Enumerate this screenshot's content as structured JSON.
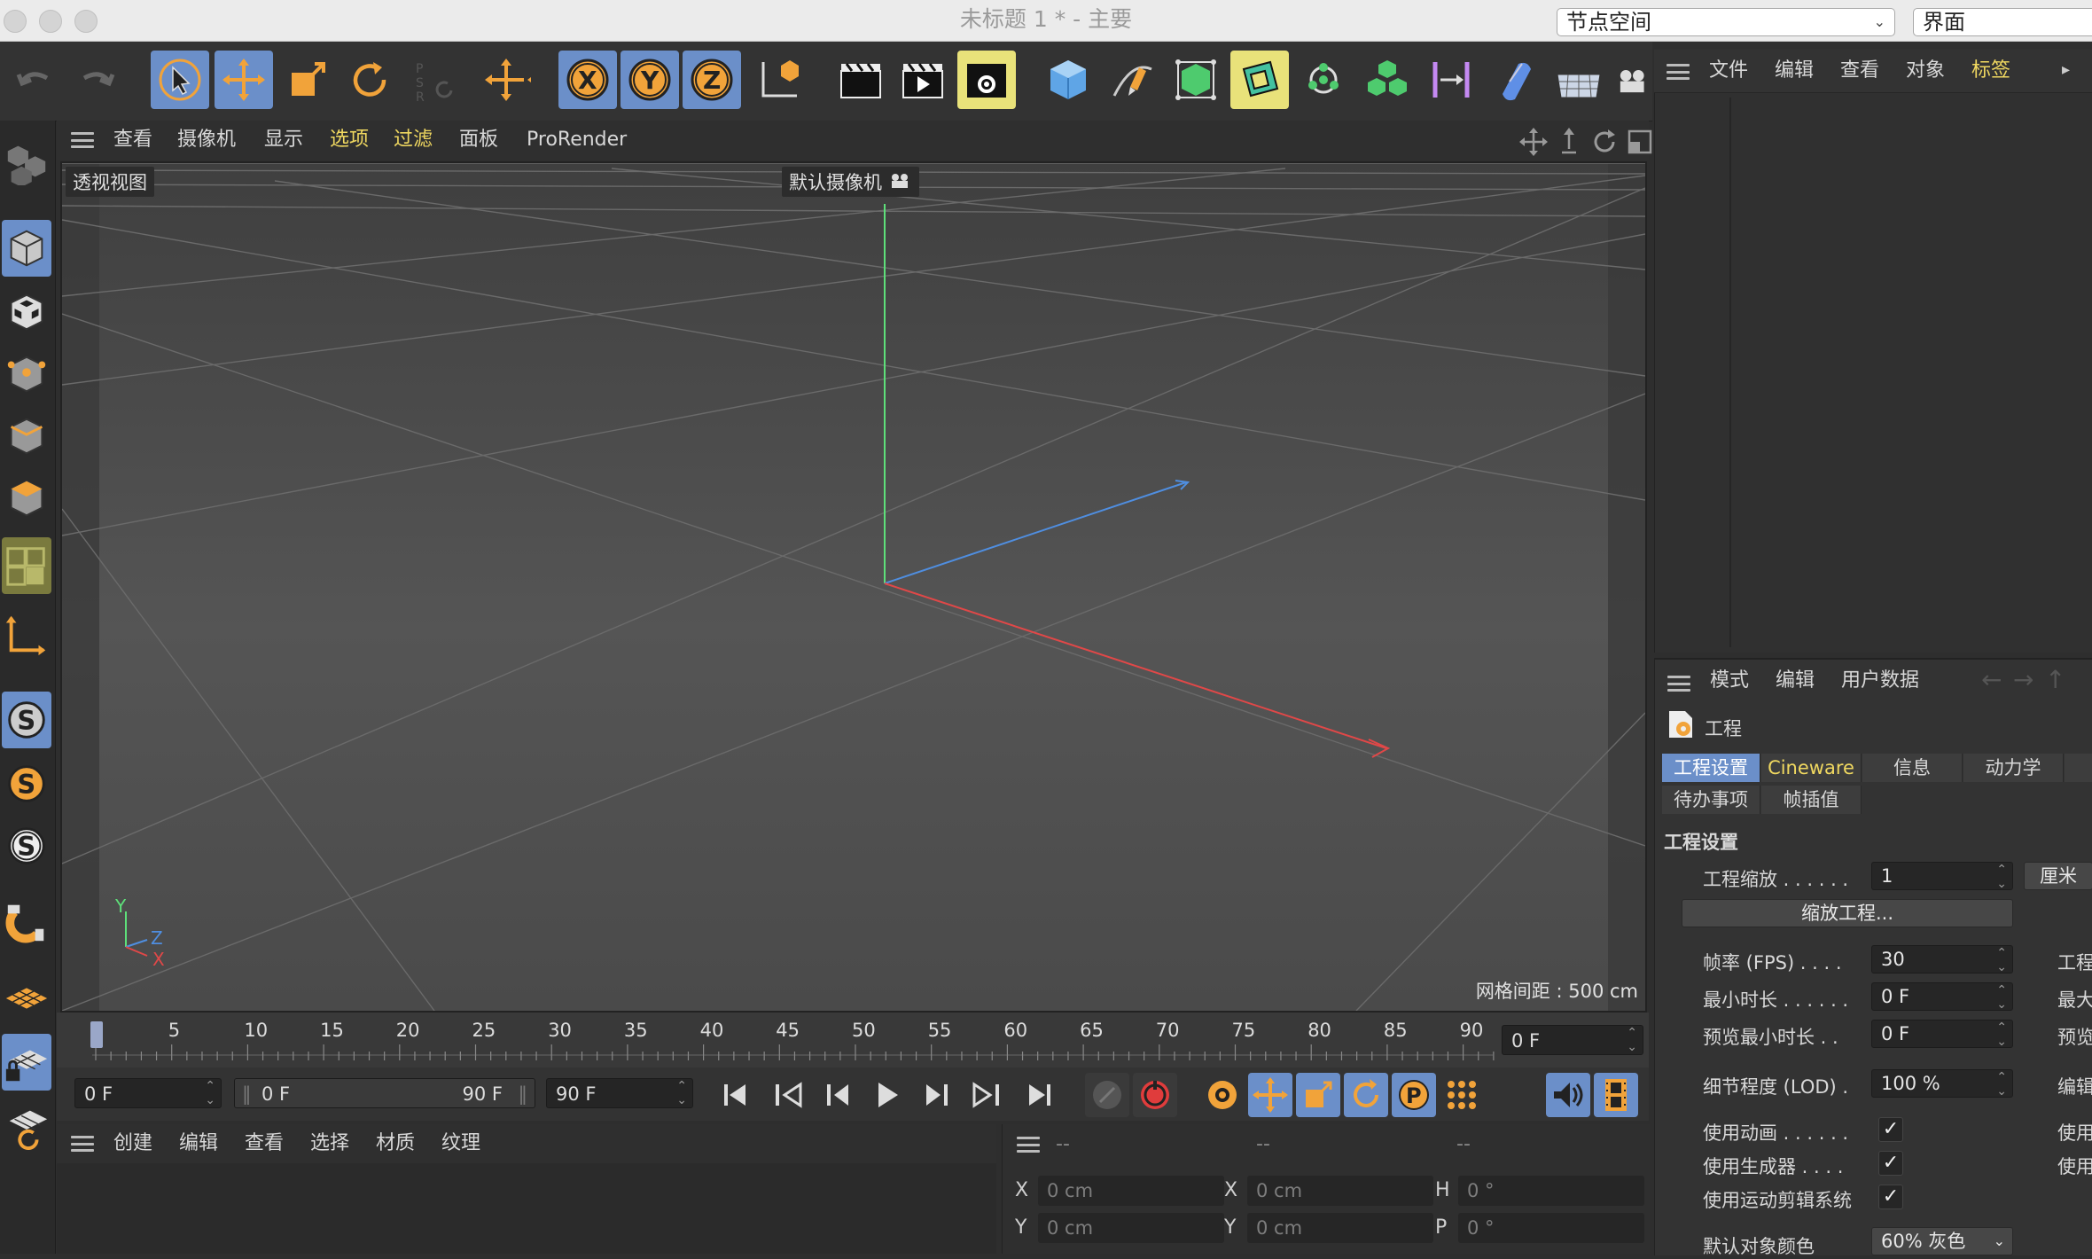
{
  "window": {
    "title": "未标题 1 * - 主要",
    "node_space_select": "节点空间",
    "layout_select": "界面"
  },
  "viewport_menu": {
    "items": [
      "查看",
      "摄像机",
      "显示",
      "选项",
      "过滤",
      "面板",
      "ProRender"
    ]
  },
  "viewport": {
    "view_label": "透视视图",
    "camera_label": "默认摄像机",
    "grid_spacing": "网格间距 : 500 cm",
    "axis_labels": {
      "y": "Y",
      "z": "Z",
      "x": "X"
    }
  },
  "timeline": {
    "ticks": [
      "0",
      "5",
      "10",
      "15",
      "20",
      "25",
      "30",
      "35",
      "40",
      "45",
      "50",
      "55",
      "60",
      "65",
      "70",
      "75",
      "80",
      "85",
      "90"
    ],
    "current_frame": "0 F"
  },
  "transport": {
    "start_field": "0 F",
    "range_start": "0 F",
    "range_end": "90 F",
    "end_field": "90 F"
  },
  "material_menu": {
    "items": [
      "创建",
      "编辑",
      "查看",
      "选择",
      "材质",
      "纹理"
    ]
  },
  "coords": {
    "header": [
      "--",
      "--",
      "--"
    ],
    "rows": [
      {
        "l1": "X",
        "v1": "0 cm",
        "l2": "X",
        "v2": "0 cm",
        "l3": "H",
        "v3": "0 °"
      },
      {
        "l1": "Y",
        "v1": "0 cm",
        "l2": "Y",
        "v2": "0 cm",
        "l3": "P",
        "v3": "0 °"
      }
    ]
  },
  "object_manager": {
    "menu": [
      "文件",
      "编辑",
      "查看",
      "对象",
      "标签"
    ]
  },
  "attributes": {
    "menu": [
      "模式",
      "编辑",
      "用户数据"
    ],
    "object_name": "工程",
    "tabs_row1": [
      "工程设置",
      "Cineware",
      "信息",
      "动力学"
    ],
    "tabs_row2": [
      "待办事项",
      "帧插值"
    ],
    "section_title": "工程设置",
    "project_scale_label": "工程缩放 . . . . . .",
    "project_scale_value": "1",
    "project_scale_unit": "厘米",
    "scale_project_button": "缩放工程...",
    "fps_label": "帧率 (FPS) . . . .",
    "fps_value": "30",
    "min_time_label": "最小时长 . . . . . .",
    "min_time_value": "0 F",
    "preview_min_label": "预览最小时长 . .",
    "preview_min_value": "0 F",
    "lod_label": "细节程度 (LOD) .",
    "lod_value": "100 %",
    "use_anim_label": "使用动画 . . . . . .",
    "use_gen_label": "使用生成器 . . . .",
    "use_motion_label": "使用运动剪辑系统",
    "default_color_label": "默认对象颜色",
    "default_color_value": "60% 灰色",
    "right_col": [
      "工程",
      "最大",
      "预览",
      "编辑",
      "使用",
      "使用"
    ]
  }
}
